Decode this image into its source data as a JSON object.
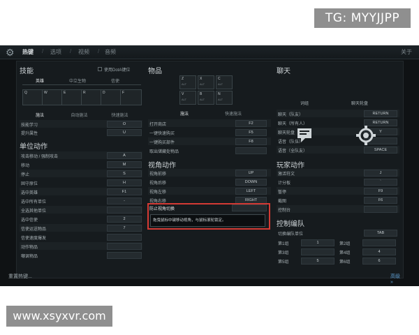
{
  "watermarks": {
    "top": "TG: MYYJJPP",
    "bottom": "www.xsyxvr.com"
  },
  "topbar": {
    "tabs": [
      "热键",
      "选项",
      "视频",
      "音频"
    ],
    "close_label": "关于"
  },
  "skills": {
    "title": "技能",
    "use_quickcast_label": "使用DotA键位",
    "tabs": [
      "英雄",
      "中立生物",
      "信使"
    ],
    "hero_keys": [
      "Q",
      "W",
      "E",
      "R",
      "D",
      "F"
    ],
    "cast_tabs": [
      "施法",
      "自动施法",
      "快速施法"
    ],
    "rows": [
      {
        "label": "技能学习",
        "key": "O"
      },
      {
        "label": "提升属性",
        "key": "U"
      }
    ]
  },
  "unit_actions": {
    "title": "单位动作",
    "rows": [
      {
        "label": "攻击移动 / 强制攻击",
        "key": "A"
      },
      {
        "label": "移动",
        "key": "M"
      },
      {
        "label": "停止",
        "key": "S"
      },
      {
        "label": "固守原位",
        "key": "H"
      },
      {
        "label": "选中英雄",
        "key": "F1"
      },
      {
        "label": "选中所有单位",
        "key": "-"
      },
      {
        "label": "全选其他单位",
        "key": ""
      },
      {
        "label": "选中信使",
        "key": "2"
      },
      {
        "label": "信使运送物品",
        "key": "7"
      },
      {
        "label": "信使速度爆发",
        "key": ""
      },
      {
        "label": "动作物品",
        "key": ""
      },
      {
        "label": "嘲讽物品",
        "key": ""
      }
    ]
  },
  "items": {
    "title": "物品",
    "slots": [
      {
        "key": "Z",
        "mod": "ALT"
      },
      {
        "key": "X",
        "mod": "ALT"
      },
      {
        "key": "C",
        "mod": "ALT"
      },
      {
        "key": "V",
        "mod": "ALT"
      },
      {
        "key": "B",
        "mod": "ALT"
      },
      {
        "key": "N",
        "mod": "ALT"
      }
    ],
    "cast_tabs": [
      "施法",
      "快速施法"
    ],
    "rows": [
      {
        "label": "打开商店",
        "key": "F2"
      },
      {
        "label": "一键快速购买",
        "key": "F5"
      },
      {
        "label": "一键购买部件",
        "key": "F8"
      },
      {
        "label": "取出储藏处物品",
        "key": ""
      }
    ]
  },
  "camera": {
    "title": "视角动作",
    "rows": [
      {
        "label": "视角前移",
        "key": "UP"
      },
      {
        "label": "视角后移",
        "key": "DOWN"
      },
      {
        "label": "视角左移",
        "key": "LEFT"
      },
      {
        "label": "视角右移",
        "key": "RIGHT"
      }
    ],
    "highlight_label": "防止视角切换",
    "tooltip": "拖曳鼠标中键移动视角，与鼠标滚轮锁定。"
  },
  "chat": {
    "title": "聊天",
    "icons": [
      "词组",
      "聊天轮盘"
    ],
    "rows": [
      {
        "label": "聊天（队友）",
        "key": "RETURN"
      },
      {
        "label": "聊天（所有人）",
        "key": "RETURN"
      },
      {
        "label": "聊天轮盘",
        "key": "Y"
      },
      {
        "label": "语音（队伍）",
        "key": ""
      },
      {
        "label": "语音（全队友）",
        "key": "SPACE"
      }
    ]
  },
  "player_actions": {
    "title": "玩家动作",
    "rows": [
      {
        "label": "激活符文",
        "key": "J"
      },
      {
        "label": "计分板",
        "key": "`"
      },
      {
        "label": "暂停",
        "key": "F9"
      },
      {
        "label": "截图",
        "key": "F6"
      },
      {
        "label": "控制台",
        "key": ""
      }
    ]
  },
  "control_groups": {
    "title": "控制编队",
    "switch_label": "切换编队单位",
    "switch_key": "TAB",
    "groups": [
      {
        "label": "第1组",
        "key": "1"
      },
      {
        "label": "第2组",
        "key": ""
      },
      {
        "label": "第3组",
        "key": ""
      },
      {
        "label": "第4组",
        "key": "4"
      },
      {
        "label": "第5组",
        "key": "5"
      },
      {
        "label": "第6组",
        "key": "6"
      }
    ]
  },
  "footer": {
    "reset_label": "重置热键...",
    "advanced_label": "高级 »"
  },
  "colors": {
    "highlight": "#d43a34",
    "link": "#5d9ccf"
  }
}
